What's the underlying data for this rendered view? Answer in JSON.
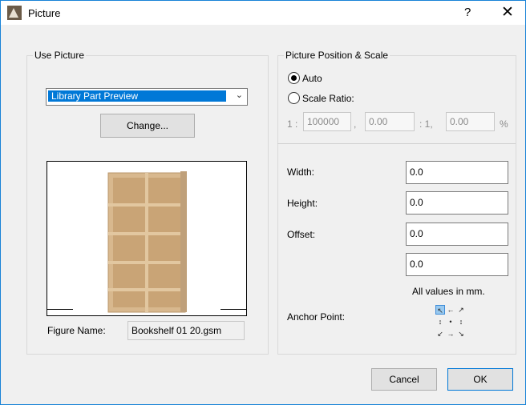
{
  "window": {
    "title": "Picture",
    "help_label": "?",
    "close_label": "✕"
  },
  "use_picture": {
    "group_title": "Use Picture",
    "dropdown_value": "Library Part Preview",
    "change_button": "Change...",
    "figure_name_label": "Figure Name:",
    "figure_name_value": "Bookshelf 01 20.gsm"
  },
  "position_scale": {
    "group_title": "Picture Position & Scale",
    "auto_label": "Auto",
    "auto_selected": true,
    "scale_ratio_label": "Scale Ratio:",
    "ratio_prefix": "1 :",
    "ratio_value": "100000",
    "comma": ",",
    "value_a": "0.00",
    "mid_label": ": 1,",
    "value_b": "0.00",
    "percent": "%"
  },
  "dimensions": {
    "width_label": "Width:",
    "width_value": "0.0",
    "height_label": "Height:",
    "height_value": "0.0",
    "offset_label": "Offset:",
    "offset_x_value": "0.0",
    "offset_y_value": "0.0",
    "units_note": "All values in mm.",
    "anchor_label": "Anchor Point:",
    "anchor_selected": "top-left"
  },
  "footer": {
    "cancel_label": "Cancel",
    "ok_label": "OK"
  },
  "colors": {
    "accent": "#0078d7",
    "shelf_wood": "#d8b88e"
  }
}
